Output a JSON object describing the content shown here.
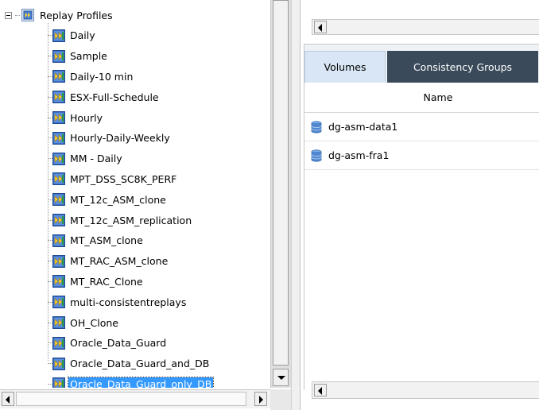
{
  "tree": {
    "root_label": "Replay Profiles",
    "items": [
      {
        "label": "Daily"
      },
      {
        "label": "Sample"
      },
      {
        "label": "Daily-10 min"
      },
      {
        "label": "ESX-Full-Schedule"
      },
      {
        "label": "Hourly"
      },
      {
        "label": "Hourly-Daily-Weekly"
      },
      {
        "label": "MM - Daily"
      },
      {
        "label": "MPT_DSS_SC8K_PERF"
      },
      {
        "label": "MT_12c_ASM_clone"
      },
      {
        "label": "MT_12c_ASM_replication"
      },
      {
        "label": "MT_ASM_clone"
      },
      {
        "label": "MT_RAC_ASM_clone"
      },
      {
        "label": "MT_RAC_Clone"
      },
      {
        "label": "multi-consistentreplays"
      },
      {
        "label": "OH_Clone"
      },
      {
        "label": "Oracle_Data_Guard"
      },
      {
        "label": "Oracle_Data_Guard_and_DB"
      },
      {
        "label": "Oracle_Data_Guard_only_DB",
        "selected": true
      }
    ]
  },
  "tabs": {
    "volumes": "Volumes",
    "consistency_groups": "Consistency Groups"
  },
  "table": {
    "column_name": "Name",
    "rows": [
      "dg-asm-data1",
      "dg-asm-fra1"
    ]
  },
  "icons": {
    "root": "replay-profiles-folder-icon",
    "item": "replay-profile-icon",
    "row": "database-volume-icon"
  },
  "colors": {
    "selection": "#3399ff",
    "active_tab": "#d9e6f5",
    "dark_tab": "#3b4a5a"
  }
}
